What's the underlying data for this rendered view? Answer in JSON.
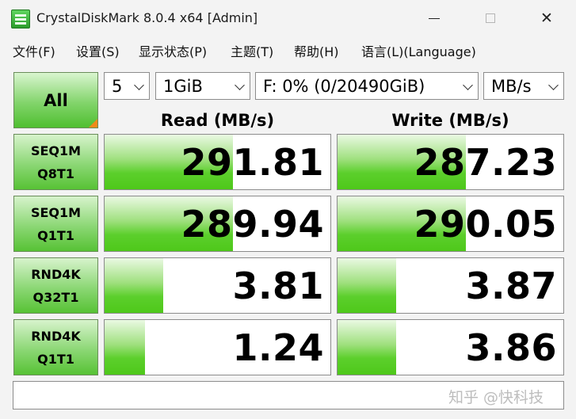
{
  "window": {
    "title": "CrystalDiskMark 8.0.4 x64 [Admin]",
    "min_icon": "minimize-icon",
    "max_icon": "maximize-icon",
    "close_glyph": "✕"
  },
  "menu": [
    "文件(F)",
    "设置(S)",
    "显示状态(P)",
    "主题(T)",
    "帮助(H)",
    "语言(L)(Language)"
  ],
  "controls": {
    "all_label": "All",
    "count": "5",
    "size": "1GiB",
    "drive": "F: 0% (0/20490GiB)",
    "unit": "MB/s"
  },
  "headers": {
    "read": "Read (MB/s)",
    "write": "Write (MB/s)"
  },
  "rows": [
    {
      "line1": "SEQ1M",
      "line2": "Q8T1",
      "read": "291.81",
      "write": "287.23",
      "read_fill": 0.57,
      "write_fill": 0.57
    },
    {
      "line1": "SEQ1M",
      "line2": "Q1T1",
      "read": "289.94",
      "write": "290.05",
      "read_fill": 0.57,
      "write_fill": 0.57
    },
    {
      "line1": "RND4K",
      "line2": "Q32T1",
      "read": "3.81",
      "write": "3.87",
      "read_fill": 0.26,
      "write_fill": 0.26
    },
    {
      "line1": "RND4K",
      "line2": "Q1T1",
      "read": "1.24",
      "write": "3.86",
      "read_fill": 0.18,
      "write_fill": 0.26
    }
  ],
  "comment": "",
  "watermark": "知乎 @快科技"
}
